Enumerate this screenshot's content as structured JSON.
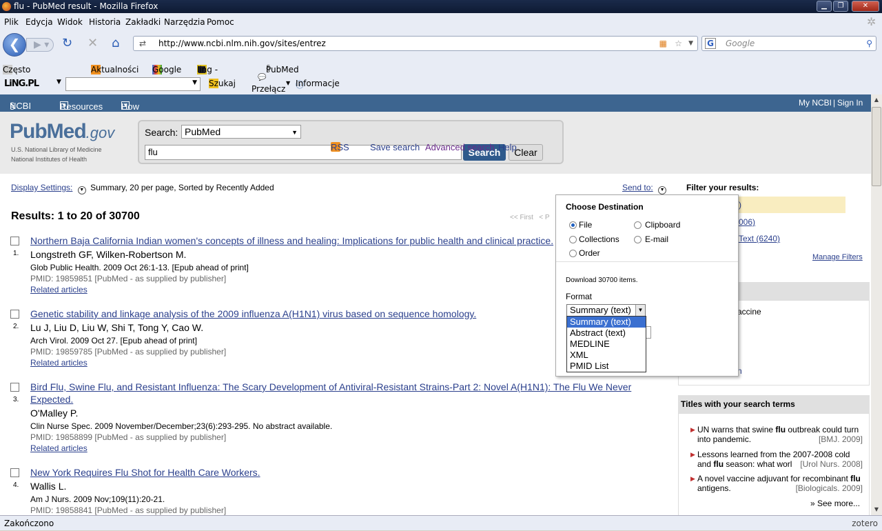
{
  "window": {
    "title": "flu - PubMed result - Mozilla Firefox"
  },
  "menu": [
    "Plik",
    "Edycja",
    "Widok",
    "Historia",
    "Zakładki",
    "Narzędzia",
    "Pomoc"
  ],
  "nav": {
    "url": "http://www.ncbi.nlm.nih.gov/sites/entrez",
    "search_placeholder": "Google"
  },
  "bookmarks": [
    "Często odwiedzane",
    "Aktualności",
    "Google",
    "ling - słownik",
    "PubMed Home"
  ],
  "lingbar": {
    "logo": "LiNG.PL",
    "search": "Szukaj",
    "switch": "Przełącz",
    "info": "Informacje"
  },
  "ncbi": {
    "logo": "NCBI",
    "resources": "Resources",
    "howto": "How To",
    "myncbi": "My NCBI",
    "sep": "|",
    "signin": "Sign In"
  },
  "pubmed": {
    "logo_pub": "Pub",
    "logo_med": "Med",
    "logo_gov": ".gov",
    "logo_sub1": "U.S. National Library of Medicine",
    "logo_sub2": "National Institutes of Health",
    "search_label": "Search:",
    "db": "PubMed",
    "query": "flu",
    "search_btn": "Search",
    "clear_btn": "Clear",
    "rss": "RSS",
    "save_search": "Save search",
    "advanced": "Advanced search",
    "help": "Help"
  },
  "display": {
    "label": "Display Settings:",
    "summary": "Summary, 20 per page, Sorted by Recently Added",
    "sendto": "Send to:",
    "pager": "<< First   < P"
  },
  "results_head": "Results: 1 to 20 of 30700",
  "results": [
    {
      "n": "1.",
      "title": "Northern Baja California Indian women's concepts of illness and healing: Implications for public health and clinical practice.",
      "authors": "Longstreth GF, Wilken-Robertson M.",
      "source": "Glob Public Health. 2009 Oct 26:1-13. [Epub ahead of print]",
      "pmid": "PMID: 19859851 [PubMed - as supplied by publisher]",
      "related": "Related articles"
    },
    {
      "n": "2.",
      "title": "Genetic stability and linkage analysis of the 2009 influenza A(H1N1) virus based on sequence homology.",
      "authors": "Lu J, Liu D, Liu W, Shi T, Tong Y, Cao W.",
      "source": "Arch Virol. 2009 Oct 27. [Epub ahead of print]",
      "pmid": "PMID: 19859785 [PubMed - as supplied by publisher]",
      "related": "Related articles"
    },
    {
      "n": "3.",
      "title": "Bird Flu, Swine Flu, and Resistant Influenza: The Scary Development of Antiviral-Resistant Strains-Part 2: Novel A(H1N1): The Flu We Never",
      "title2": "Expected.",
      "authors": "O'Malley P.",
      "source": "Clin Nurse Spec. 2009 November/December;23(6):293-295. No abstract available.",
      "pmid": "PMID: 19858899 [PubMed - as supplied by publisher]",
      "related": "Related articles"
    },
    {
      "n": "4.",
      "title": "New York Requires Flu Shot for Health Care Workers.",
      "authors": "Wallis L.",
      "source": "Am J Nurs. 2009 Nov;109(11):20-21.",
      "pmid": "PMID: 19858841 [PubMed - as supplied by publisher]"
    }
  ],
  "filters": {
    "head": "Filter your results:",
    "item1": ")",
    "item2": "006)",
    "item3": "Text (6240)",
    "manage": "Manage Filters",
    "partial": "accine",
    "partial2": "n"
  },
  "titles_box": {
    "head": "Titles with your search terms",
    "items": [
      {
        "pre": "UN warns that swine ",
        "bold": "flu",
        "post": " outbreak could turn into pandemic.",
        "src": "[BMJ. 2009]"
      },
      {
        "pre": "Lessons learned from the 2007-2008 cold and ",
        "bold": "flu",
        "post": " season: what worl",
        "src": "[Urol Nurs. 2008]"
      },
      {
        "pre": "A novel vaccine adjuvant for recombinant ",
        "bold": "flu",
        "post": " antigens.",
        "src": "[Biologicals. 2009]"
      }
    ],
    "more": "» See more..."
  },
  "popup": {
    "head": "Choose Destination",
    "opt_file": "File",
    "opt_clipboard": "Clipboard",
    "opt_collections": "Collections",
    "opt_email": "E-mail",
    "opt_order": "Order",
    "download": "Download 30700 items.",
    "format_label": "Format",
    "format_value": "Summary (text)",
    "format_options": [
      "Summary (text)",
      "Abstract (text)",
      "MEDLINE",
      "XML",
      "PMID List"
    ]
  },
  "status": {
    "text": "Zakończono",
    "zotero": "zotero"
  }
}
